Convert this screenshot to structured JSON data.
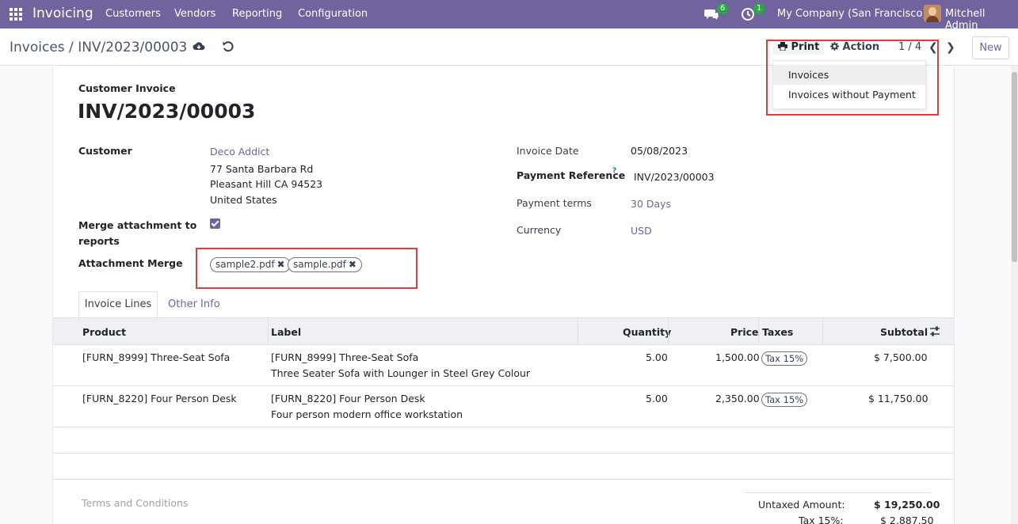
{
  "navbar": {
    "app_name": "Invoicing",
    "menu": [
      "Customers",
      "Vendors",
      "Reporting",
      "Configuration"
    ],
    "messages_count": "6",
    "activities_count": "1",
    "company": "My Company (San Francisco)",
    "user": "Mitchell Admin",
    "accent_color": "#71639e"
  },
  "control": {
    "breadcrumb_parent": "Invoices",
    "breadcrumb_separator": "/",
    "breadcrumb_current": "INV/2023/00003",
    "print_label": "Print",
    "action_label": "Action",
    "pager": "1 / 4",
    "new_label": "New"
  },
  "print_menu": {
    "items": [
      "Invoices",
      "Invoices without Payment"
    ]
  },
  "invoice": {
    "type_label": "Customer Invoice",
    "number": "INV/2023/00003",
    "customer_label": "Customer",
    "customer_name": "Deco Addict",
    "address_line1": "77 Santa Barbara Rd",
    "address_line2": "Pleasant Hill CA 94523",
    "address_line3": "United States",
    "merge_label": "Merge attachment to reports",
    "merge_checked": true,
    "attachment_label": "Attachment Merge",
    "attachments": [
      "sample2.pdf",
      "sample.pdf"
    ],
    "invoice_date_label": "Invoice Date",
    "invoice_date": "05/08/2023",
    "payment_ref_label": "Payment Reference",
    "payment_ref_help": "?",
    "payment_ref": "INV/2023/00003",
    "payment_terms_label": "Payment terms",
    "payment_terms": "30 Days",
    "currency_label": "Currency",
    "currency": "USD"
  },
  "tabs": [
    "Invoice Lines",
    "Other Info"
  ],
  "table": {
    "headers": [
      "Product",
      "Label",
      "Quantity",
      "Price",
      "Taxes",
      "Subtotal"
    ],
    "rows": [
      {
        "product": "[FURN_8999] Three-Seat Sofa",
        "label1": "[FURN_8999] Three-Seat Sofa",
        "label2": "Three Seater Sofa with Lounger in Steel Grey Colour",
        "quantity": "5.00",
        "price": "1,500.00",
        "tax": "Tax 15%",
        "subtotal": "$ 7,500.00"
      },
      {
        "product": "[FURN_8220] Four Person Desk",
        "label1": "[FURN_8220] Four Person Desk",
        "label2": "Four person modern office workstation",
        "quantity": "5.00",
        "price": "2,350.00",
        "tax": "Tax 15%",
        "subtotal": "$ 11,750.00"
      }
    ]
  },
  "footer": {
    "terms_placeholder": "Terms and Conditions",
    "untaxed_label": "Untaxed Amount:",
    "untaxed_value": "$ 19,250.00",
    "tax_label": "Tax 15%:",
    "tax_value": "$ 2,887.50"
  }
}
